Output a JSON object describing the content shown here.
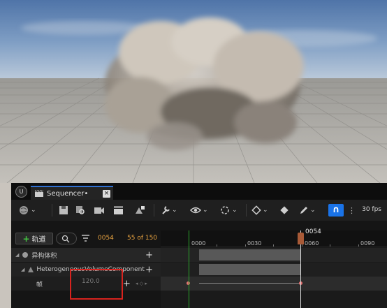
{
  "tab": {
    "title": "Sequencer•",
    "close": "×"
  },
  "toolbar": {
    "fps": "30 fps",
    "magnet": "∩"
  },
  "controls": {
    "add_track": "轨道",
    "add_plus": "+",
    "current_frame": "0054",
    "frame_count": "55 of 150"
  },
  "outliner": {
    "rows": [
      {
        "label": "异构体积",
        "plus": "+"
      },
      {
        "label": "HeterogeneousVolumeComponent",
        "plus": "+"
      },
      {
        "label": "帧",
        "value": "120.0",
        "plus": "+",
        "keynav": "◂ ◇ ▸"
      }
    ]
  },
  "timeline": {
    "playhead_label": "0054",
    "ticks": [
      "0000",
      "0030",
      "0060",
      "0090"
    ]
  },
  "colors": {
    "accent": "#2f6fd1",
    "highlight_box": "#d8231e",
    "playhead": "#a85a37",
    "start_marker": "#2aa62a"
  }
}
